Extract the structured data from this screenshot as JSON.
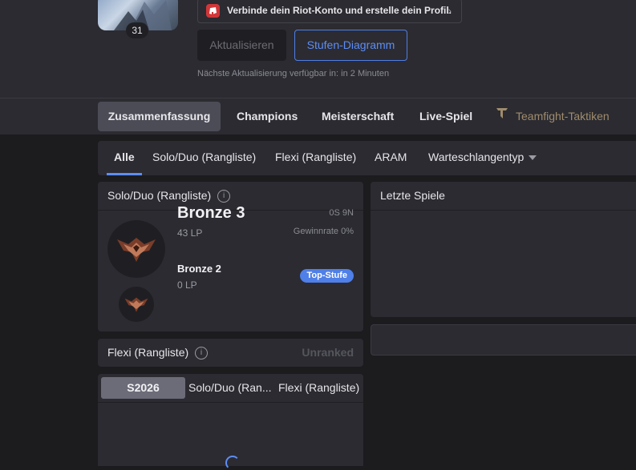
{
  "profile": {
    "level": "31",
    "riot_banner": "Verbinde dein Riot-Konto und erstelle dein Profil.",
    "update_button": "Aktualisieren",
    "tier_graph_button": "Stufen-Diagramm",
    "next_update": "Nächste Aktualisierung verfügbar in: in 2 Minuten"
  },
  "nav": {
    "tabs": [
      "Zusammenfassung",
      "Champions",
      "Meisterschaft",
      "Live-Spiel",
      "Teamfight-Taktiken"
    ],
    "active": "Zusammenfassung"
  },
  "queue": {
    "tabs": [
      "Alle",
      "Solo/Duo (Rangliste)",
      "Flexi (Rangliste)",
      "ARAM",
      "Warteschlangentyp"
    ],
    "active": "Alle"
  },
  "solo": {
    "title": "Solo/Duo (Rangliste)",
    "tier": "Bronze 3",
    "lp": "43 LP",
    "record": "0S 9N",
    "winrate": "Gewinnrate 0%",
    "peak_tier": "Bronze 2",
    "peak_lp": "0 LP",
    "peak_badge": "Top-Stufe"
  },
  "flex": {
    "title": "Flexi (Rangliste)",
    "status": "Unranked"
  },
  "season": {
    "tabs": [
      "S2026",
      "Solo/Duo (Ran...",
      "Flexi (Rangliste)"
    ]
  },
  "recent": {
    "title": "Letzte Spiele"
  },
  "colors": {
    "accent": "#4f7fe8",
    "riot_red": "#d13639",
    "panel": "#2b2b31",
    "background": "#1c1c1f"
  }
}
